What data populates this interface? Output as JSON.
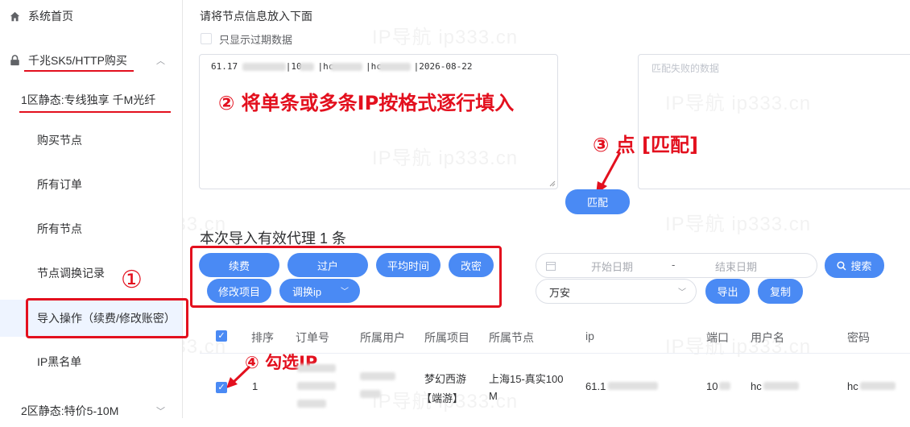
{
  "sidebar": {
    "home": "系统首页",
    "group1": "千兆SK5/HTTP购买",
    "group1_sub": "1区静态:专线独享 千M光纤",
    "items": [
      "购买节点",
      "所有订单",
      "所有节点",
      "节点调换记录",
      "导入操作（续费/修改账密）",
      "IP黑名单"
    ],
    "group2": "2区静态:特价5-10M"
  },
  "main": {
    "section_label": "请将节点信息放入下面",
    "only_expired": "只显示过期数据",
    "textarea_value": "61.17         |10   |hc      |hc      |2026-08-22",
    "failed_placeholder": "匹配失败的数据",
    "match_button": "匹配",
    "result_title": "本次导入有效代理 1 条",
    "action_buttons": [
      "续费",
      "过户",
      "平均时间",
      "改密",
      "修改项目",
      "调换ip"
    ],
    "start_date": "开始日期",
    "date_sep": "-",
    "end_date": "结束日期",
    "search_button": "搜索",
    "select_value": "万安",
    "export_button": "导出",
    "copy_button": "复制"
  },
  "annotations": {
    "a1": "①",
    "a2": "② 将单条或多条IP按格式逐行填入",
    "a3": "③ 点 [匹配]",
    "a4": "④ 勾选IP"
  },
  "table": {
    "headers": [
      "排序",
      "订单号",
      "所属用户",
      "所属项目",
      "所属节点",
      "ip",
      "端口",
      "用户名",
      "密码"
    ],
    "row": {
      "index": "1",
      "project_l1": "梦幻西游",
      "project_l2": "【端游】",
      "node_l1": "上海15-真实100",
      "node_l2": "M",
      "ip": "61.1",
      "port": "10",
      "username": "hc",
      "password": "hc"
    }
  },
  "watermark": "IP导航  ip333.cn",
  "colors": {
    "accent": "#4a8af4",
    "annotation": "#e3101e"
  }
}
